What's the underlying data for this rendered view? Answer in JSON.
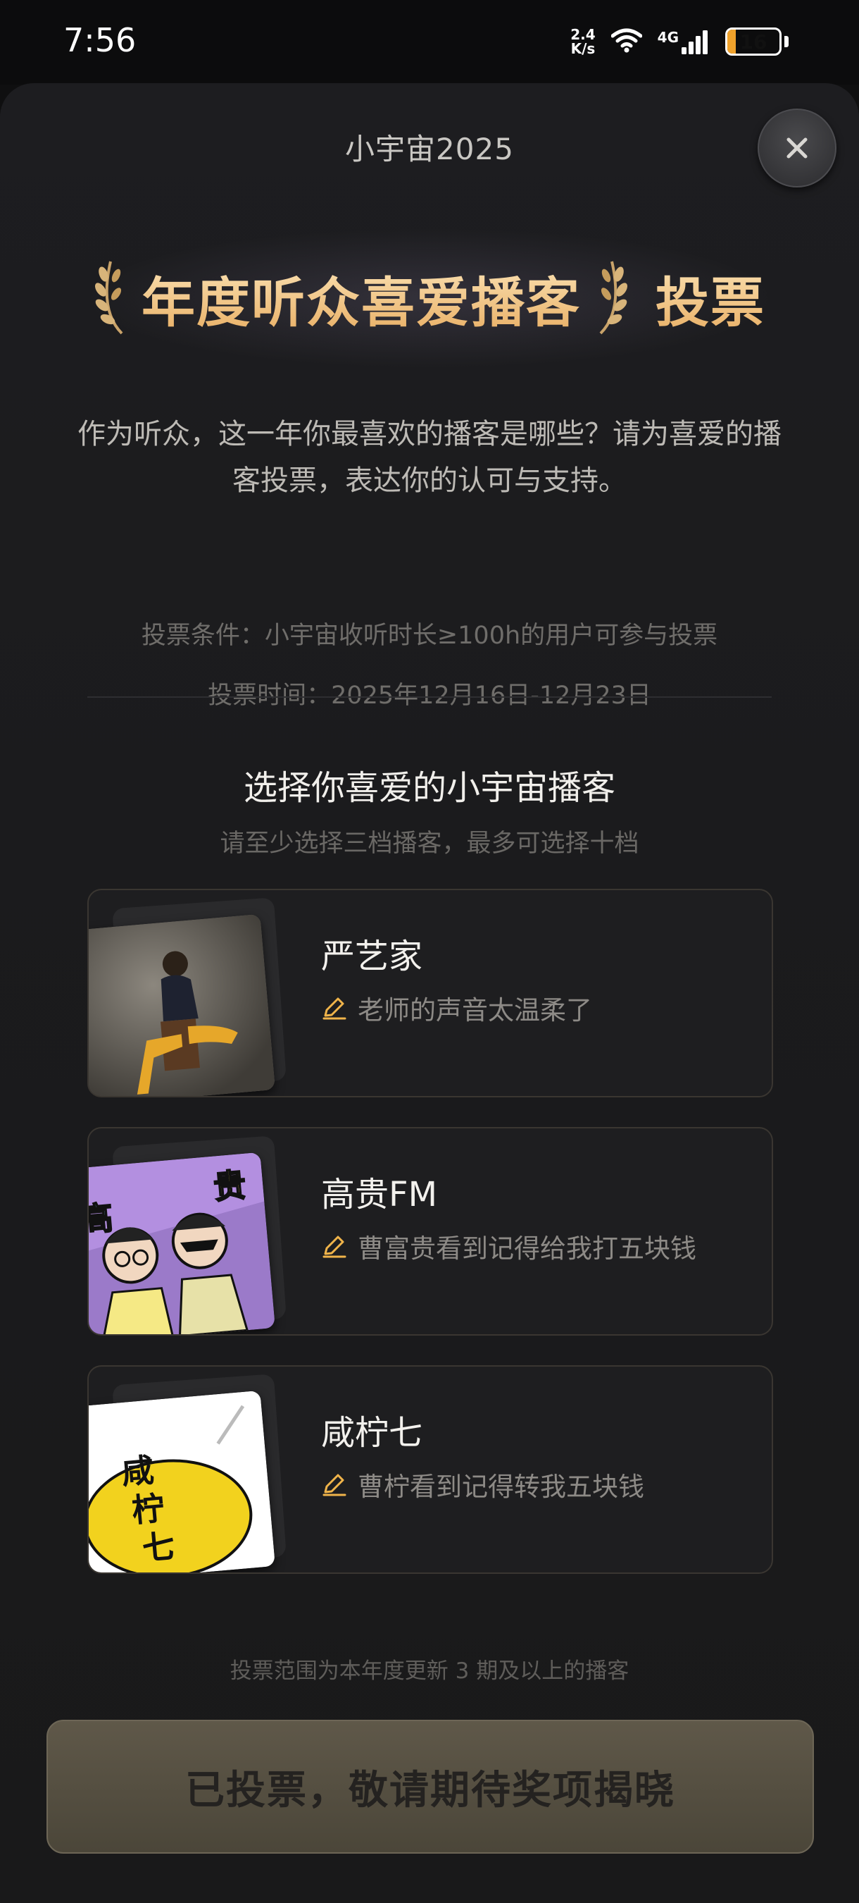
{
  "status_bar": {
    "time": "7:56",
    "net_speed_value": "2.4",
    "net_speed_unit": "K/s",
    "network_type": "4G",
    "battery_level": "16",
    "battery_fraction": 0.16,
    "battery_color": "#f0a22b"
  },
  "header": {
    "title": "小宇宙2025",
    "close_icon": "close-icon"
  },
  "hero": {
    "title": "年度听众喜爱播客",
    "vote": "投票",
    "accent_color": "#f2c98a"
  },
  "intro": {
    "text": "作为听众，这一年你最喜欢的播客是哪些？请为喜爱的播客投票，表达你的认可与支持。",
    "condition": "投票条件：小宇宙收听时长≥100h的用户可参与投票",
    "time": "投票时间：2025年12月16日-12月23日"
  },
  "section": {
    "title": "选择你喜爱的小宇宙播客",
    "subtitle": "请至少选择三档播客，最多可选择十档"
  },
  "podcasts": [
    {
      "name": "严艺家",
      "comment": "老师的声音太温柔了"
    },
    {
      "name": "高贵FM",
      "comment": "曹富贵看到记得给我打五块钱"
    },
    {
      "name": "咸柠七",
      "comment": "曹柠看到记得转我五块钱",
      "cover_text": "咸柠七"
    }
  ],
  "footer": {
    "note": "投票范围为本年度更新 3 期及以上的播客",
    "button_label": "已投票，敬请期待奖项揭晓"
  }
}
